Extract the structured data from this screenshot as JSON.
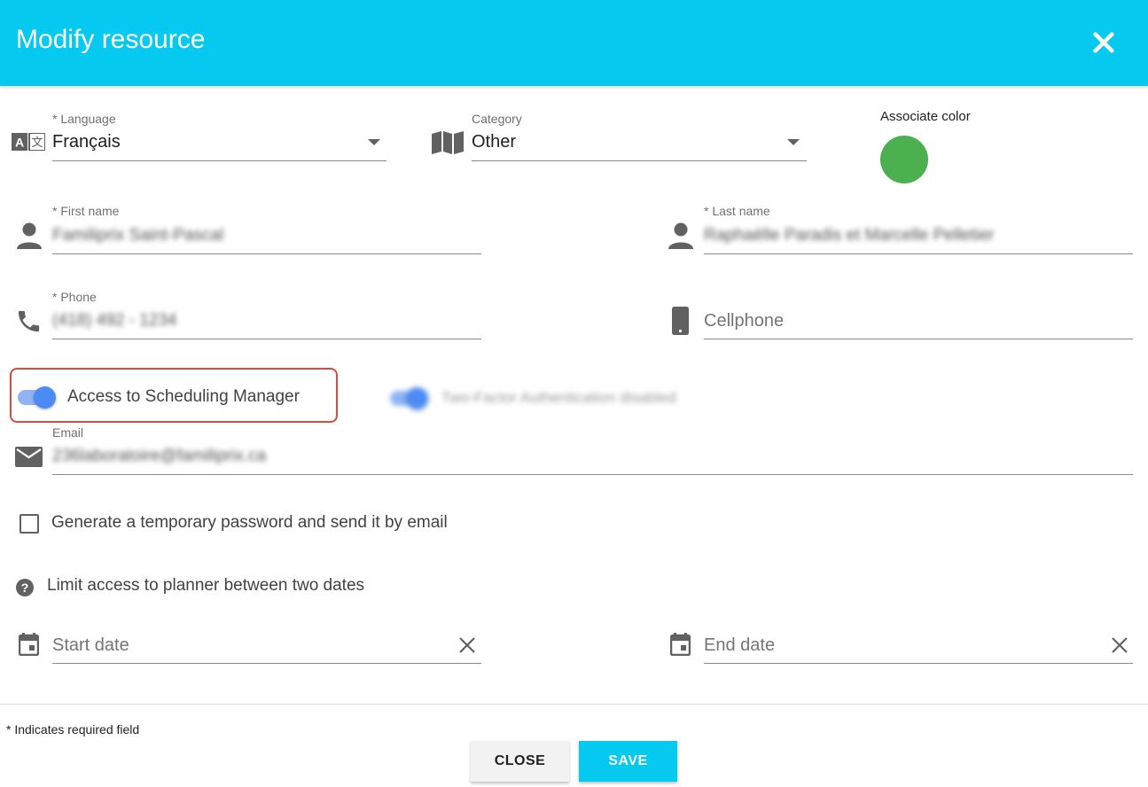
{
  "header": {
    "title": "Modify resource"
  },
  "language": {
    "label": "* Language",
    "value": "Français"
  },
  "category": {
    "label": "Category",
    "value": "Other"
  },
  "color": {
    "label": "Associate color",
    "value": "#4caf50"
  },
  "first_name": {
    "label": "* First name",
    "value": "Familiprix Saint-Pascal"
  },
  "last_name": {
    "label": "* Last name",
    "value": "Raphaëlle Paradis et Marcelle Pelletier"
  },
  "phone": {
    "label": "* Phone",
    "value": "(418) 492 - 1234"
  },
  "cellphone": {
    "placeholder": "Cellphone"
  },
  "access_toggle": {
    "label": "Access to Scheduling Manager",
    "on": true
  },
  "two_factor": {
    "label": "Two-Factor Authentication disabled",
    "on": true
  },
  "email": {
    "label": "Email",
    "value": "236laboratoire@familiprix.ca"
  },
  "temp_password": {
    "label": "Generate a temporary password and send it by email",
    "checked": false
  },
  "limit_access": {
    "label": "Limit access to planner between two dates"
  },
  "start_date": {
    "placeholder": "Start date"
  },
  "end_date": {
    "placeholder": "End date"
  },
  "footer": {
    "required_note": "* Indicates required field",
    "close_label": "CLOSE",
    "save_label": "SAVE"
  },
  "colors": {
    "header": "#06c9f0",
    "toggle_track": "#8fb3f5",
    "toggle_knob": "#4c8bf5",
    "highlight": "#d84c3c"
  }
}
